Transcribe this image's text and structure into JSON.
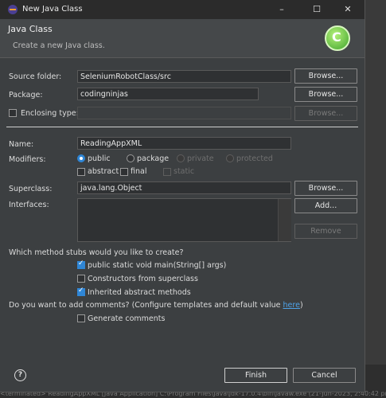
{
  "window": {
    "title": "New Java Class",
    "minimize": "–",
    "maximize": "☐",
    "close": "✕"
  },
  "banner": {
    "title": "Java Class",
    "subtitle": "Create a new Java class."
  },
  "source_folder": {
    "label": "Source folder:",
    "value": "SeleniumRobotClass/src",
    "browse": "Browse..."
  },
  "package": {
    "label": "Package:",
    "value": "codingninjas",
    "browse": "Browse..."
  },
  "enclosing": {
    "label": "Enclosing type:",
    "value": "",
    "browse": "Browse..."
  },
  "name": {
    "label": "Name:",
    "value": "ReadingAppXML"
  },
  "modifiers": {
    "label": "Modifiers:",
    "public": "public",
    "package": "package",
    "private": "private",
    "protected": "protected",
    "abstract": "abstract",
    "final": "final",
    "static": "static"
  },
  "superclass": {
    "label": "Superclass:",
    "value": "java.lang.Object",
    "browse": "Browse..."
  },
  "interfaces": {
    "label": "Interfaces:",
    "add": "Add...",
    "remove": "Remove"
  },
  "stubs": {
    "question": "Which method stubs would you like to create?",
    "main": "public static void main(String[] args)",
    "constructors": "Constructors from superclass",
    "inherited": "Inherited abstract methods"
  },
  "comments": {
    "question": "Do you want to add comments? (Configure templates and default value ",
    "link": "here",
    "close_paren": ")",
    "generate": "Generate comments"
  },
  "footer": {
    "help": "?",
    "finish": "Finish",
    "cancel": "Cancel"
  },
  "background": {
    "status": "<terminated> ReadingAppXML [Java Application] C:\\Program Files\\Java\\jdk-17.0.4\\bin\\javaw.exe (21-Jun-2023, 2:40:42 pm – 2:40:45 pm)"
  }
}
